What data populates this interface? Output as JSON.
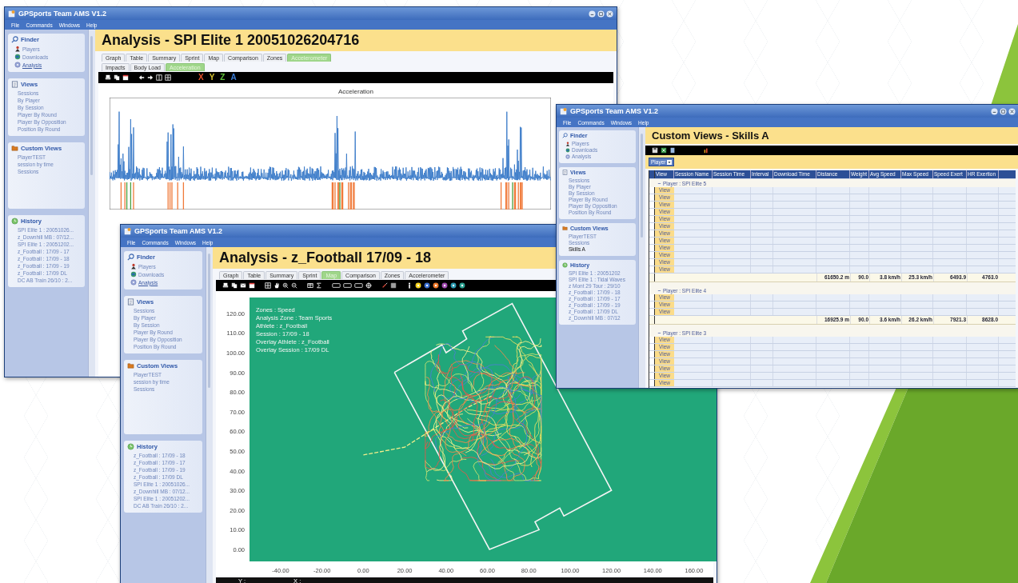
{
  "windows": [
    {
      "kind": "graph",
      "title": "GPSports Team AMS V1.2",
      "menu": [
        "File",
        "Commands",
        "Windows",
        "Help"
      ],
      "sidebar": [
        {
          "kind": "finder",
          "title": "Finder",
          "items": [
            {
              "label": "Players",
              "selected": false
            },
            {
              "label": "Downloads",
              "selected": false
            },
            {
              "label": "Analysis",
              "selected": true
            }
          ]
        },
        {
          "kind": "views",
          "title": "Views",
          "items": [
            {
              "label": "Sessions",
              "selected": false
            },
            {
              "label": "By Player",
              "selected": false
            },
            {
              "label": "By Session",
              "selected": false
            },
            {
              "label": "Player By Round",
              "selected": false
            },
            {
              "label": "Player By Opposition",
              "selected": false
            },
            {
              "label": "Position By Round",
              "selected": false
            }
          ]
        },
        {
          "kind": "custom",
          "title": "Custom Views",
          "items": [
            {
              "label": "PlayerTEST",
              "selected": false
            },
            {
              "label": "session by time",
              "selected": false
            },
            {
              "label": "Sessions",
              "selected": false
            }
          ]
        },
        {
          "kind": "history",
          "title": "History",
          "items": [
            {
              "label": "SPI Elite 1 : 20051026...",
              "selected": false
            },
            {
              "label": "z_Downhill MB : 07/12...",
              "selected": false
            },
            {
              "label": "SPI Elite 1 : 20051202...",
              "selected": false
            },
            {
              "label": "z_Football : 17/09 - 17",
              "selected": false
            },
            {
              "label": "z_Football : 17/09 - 18",
              "selected": false
            },
            {
              "label": "z_Football : 17/09 - 19",
              "selected": false
            },
            {
              "label": "z_Football : 17/09 DL",
              "selected": false
            },
            {
              "label": "DC AB Train 26/10 : 2...",
              "selected": false
            }
          ]
        }
      ],
      "heading": "Analysis - SPI Elite 1 20051026204716",
      "tabs": [
        {
          "label": "Graph",
          "selected": false
        },
        {
          "label": "Table",
          "selected": false
        },
        {
          "label": "Summary",
          "selected": false
        },
        {
          "label": "Sprint",
          "selected": false
        },
        {
          "label": "Map",
          "selected": false
        },
        {
          "label": "Comparison",
          "selected": false
        },
        {
          "label": "Zones",
          "selected": false
        },
        {
          "label": "Accelerometer",
          "selected": true
        }
      ],
      "subtabs": [
        {
          "label": "Impacts",
          "selected": false
        },
        {
          "label": "Body Load",
          "selected": false
        },
        {
          "label": "Acceleration",
          "selected": true
        }
      ],
      "axis_letters": [
        {
          "label": "X",
          "color": "#e8532a"
        },
        {
          "label": "Y",
          "color": "#d8c531"
        },
        {
          "label": "Z",
          "color": "#5fbf3a"
        },
        {
          "label": "A",
          "color": "#3a7bd5"
        }
      ],
      "chart_title": "Acceleration"
    },
    {
      "kind": "map",
      "title": "GPSports Team AMS V1.2",
      "menu": [
        "File",
        "Commands",
        "Windows",
        "Help"
      ],
      "sidebar": [
        {
          "kind": "finder",
          "title": "Finder",
          "items": [
            {
              "label": "Players",
              "selected": false
            },
            {
              "label": "Downloads",
              "selected": false
            },
            {
              "label": "Analysis",
              "selected": true
            }
          ]
        },
        {
          "kind": "views",
          "title": "Views",
          "items": [
            {
              "label": "Sessions",
              "selected": false
            },
            {
              "label": "By Player",
              "selected": false
            },
            {
              "label": "By Session",
              "selected": false
            },
            {
              "label": "Player By Round",
              "selected": false
            },
            {
              "label": "Player By Opposition",
              "selected": false
            },
            {
              "label": "Position By Round",
              "selected": false
            }
          ]
        },
        {
          "kind": "custom",
          "title": "Custom Views",
          "items": [
            {
              "label": "PlayerTEST",
              "selected": false
            },
            {
              "label": "session by time",
              "selected": false
            },
            {
              "label": "Sessions",
              "selected": false
            }
          ]
        },
        {
          "kind": "history",
          "title": "History",
          "items": [
            {
              "label": "z_Football : 17/09 - 18",
              "selected": false
            },
            {
              "label": "z_Football : 17/09 - 17",
              "selected": false
            },
            {
              "label": "z_Football : 17/09 - 19",
              "selected": false
            },
            {
              "label": "z_Football : 17/09 DL",
              "selected": false
            },
            {
              "label": "SPI Elite 1 : 20051026...",
              "selected": false
            },
            {
              "label": "z_Downhill MB : 07/12...",
              "selected": false
            },
            {
              "label": "SPI Elite 1 : 20051202...",
              "selected": false
            },
            {
              "label": "DC AB Train 26/10 : 2...",
              "selected": false
            }
          ]
        }
      ],
      "heading": "Analysis - z_Football 17/09 - 18",
      "tabs": [
        {
          "label": "Graph",
          "selected": false
        },
        {
          "label": "Table",
          "selected": false
        },
        {
          "label": "Summary",
          "selected": false
        },
        {
          "label": "Sprint",
          "selected": false
        },
        {
          "label": "Map",
          "selected": true
        },
        {
          "label": "Comparison",
          "selected": false
        },
        {
          "label": "Zones",
          "selected": false
        },
        {
          "label": "Accelerometer",
          "selected": false
        }
      ],
      "legend": [
        "Zones : Speed",
        "Analysis Zone : Team Sports",
        "Athlete : z_Football",
        "Session : 17/09 - 18",
        "Overlay Athlete : z_Football",
        "Overlay Session : 17/09 DL"
      ],
      "y_ticks": [
        "120.00",
        "110.00",
        "100.00",
        "90.00",
        "80.00",
        "70.00",
        "60.00",
        "50.00",
        "40.00",
        "30.00",
        "20.00",
        "10.00",
        "0.00"
      ],
      "x_ticks": [
        "-40.00",
        "-20.00",
        "0.00",
        "20.00",
        "40.00",
        "60.00",
        "80.00",
        "100.00",
        "120.00",
        "140.00",
        "160.00"
      ],
      "status": [
        "Y :",
        "X :"
      ]
    },
    {
      "kind": "table",
      "title": "GPSports Team AMS V1.2",
      "menu": [
        "File",
        "Commands",
        "Windows",
        "Help"
      ],
      "sidebar": [
        {
          "kind": "finder",
          "title": "Finder",
          "items": [
            {
              "label": "Players",
              "selected": false
            },
            {
              "label": "Downloads",
              "selected": false
            },
            {
              "label": "Analysis",
              "selected": false
            }
          ]
        },
        {
          "kind": "views",
          "title": "Views",
          "items": [
            {
              "label": "Sessions",
              "selected": false
            },
            {
              "label": "By Player",
              "selected": false
            },
            {
              "label": "By Session",
              "selected": false
            },
            {
              "label": "Player By Round",
              "selected": false
            },
            {
              "label": "Player By Opposition",
              "selected": false
            },
            {
              "label": "Position By Round",
              "selected": false
            }
          ]
        },
        {
          "kind": "custom",
          "title": "Custom Views",
          "items": [
            {
              "label": "PlayerTEST",
              "selected": false
            },
            {
              "label": "Sessions",
              "selected": false
            },
            {
              "label": "Skills A",
              "selected": true
            }
          ]
        },
        {
          "kind": "history",
          "title": "History",
          "items": [
            {
              "label": "SPI Elite 1 : 20051202",
              "selected": false
            },
            {
              "label": "SPI Elite 1 : Tidal Waves",
              "selected": false
            },
            {
              "label": "z Mont 29 Tour : 29/10",
              "selected": false
            },
            {
              "label": "z_Football : 17/09 - 18",
              "selected": false
            },
            {
              "label": "z_Football : 17/09 - 17",
              "selected": false
            },
            {
              "label": "z_Football : 17/09 - 19",
              "selected": false
            },
            {
              "label": "z_Football : 17/09 DL",
              "selected": false
            },
            {
              "label": "z_Downhill MB : 07/12",
              "selected": false
            }
          ]
        }
      ],
      "heading": "Custom Views - Skills A",
      "group_by": "Player",
      "columns": [
        "View",
        "Session Name",
        "Session Time",
        "Interval",
        "Download Time",
        "Distance",
        "Weight",
        "Avg Speed",
        "Max Speed",
        "Speed Exert",
        "HR Exertion"
      ],
      "groups": [
        {
          "label": "Player : SPI Elite 5",
          "rows": [
            "View",
            "View",
            "View",
            "View",
            "View",
            "View",
            "View",
            "View",
            "View",
            "View",
            "View",
            "View"
          ],
          "totals": [
            "61650.2 m",
            "90.0",
            "3.8 km/h",
            "25.3 km/h",
            "6493.9",
            "4763.0"
          ]
        },
        {
          "label": "Player : SPI Elite 4",
          "rows": [
            "View",
            "View",
            "View"
          ],
          "totals": [
            "16925.9 m",
            "90.0",
            "3.6 km/h",
            "26.2 km/h",
            "7921.3",
            "8628.0"
          ]
        },
        {
          "label": "Player : SPI Elite 3",
          "rows": [
            "View",
            "View",
            "View",
            "View",
            "View",
            "View",
            "View"
          ]
        }
      ]
    }
  ]
}
